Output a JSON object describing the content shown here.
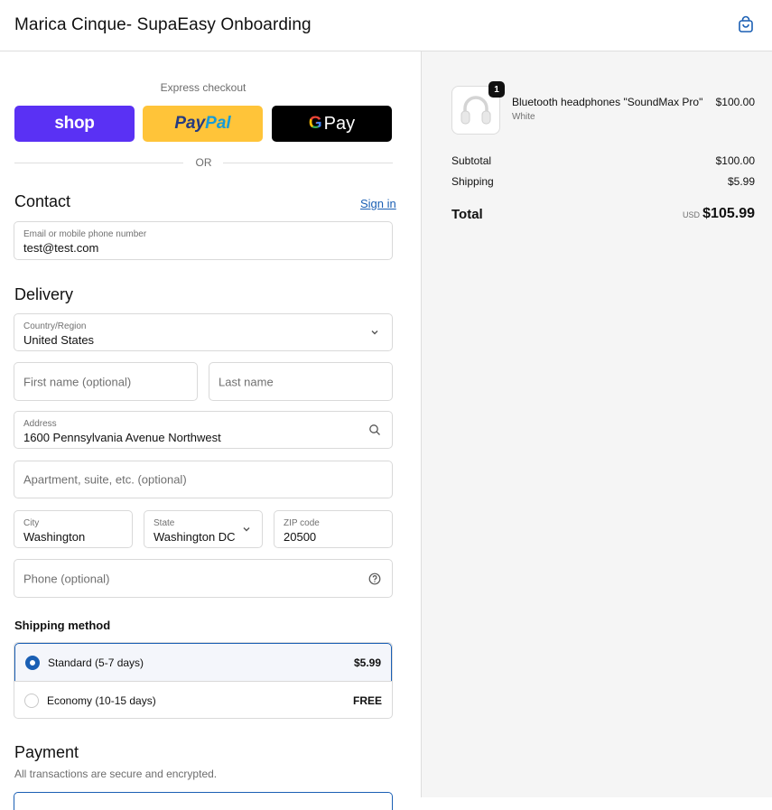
{
  "header": {
    "store_name": "Marica Cinque- SupaEasy Onboarding",
    "cart_icon": "shopping-bag-icon"
  },
  "express": {
    "label": "Express checkout",
    "shop_label": "shop",
    "paypal_part1": "Pay",
    "paypal_part2": "Pal",
    "gpay_g": "G",
    "gpay_label": "Pay",
    "or_label": "OR"
  },
  "contact": {
    "title": "Contact",
    "sign_in": "Sign in",
    "email_label": "Email or mobile phone number",
    "email_value": "test@test.com"
  },
  "delivery": {
    "title": "Delivery",
    "country_label": "Country/Region",
    "country_value": "United States",
    "first_name_placeholder": "First name (optional)",
    "last_name_placeholder": "Last name",
    "address_label": "Address",
    "address_value": "1600 Pennsylvania Avenue Northwest",
    "apartment_placeholder": "Apartment, suite, etc. (optional)",
    "city_label": "City",
    "city_value": "Washington",
    "state_label": "State",
    "state_value": "Washington DC",
    "zip_label": "ZIP code",
    "zip_value": "20500",
    "phone_placeholder": "Phone (optional)"
  },
  "shipping": {
    "title": "Shipping method",
    "options": [
      {
        "name": "Standard (5-7 days)",
        "price": "$5.99",
        "selected": true
      },
      {
        "name": "Economy (10-15 days)",
        "price": "FREE",
        "selected": false
      }
    ]
  },
  "payment": {
    "title": "Payment",
    "subtitle": "All transactions are secure and encrypted."
  },
  "summary": {
    "product": {
      "quantity": "1",
      "name": "Bluetooth headphones \"SoundMax Pro\"",
      "variant": "White",
      "price": "$100.00"
    },
    "subtotal_label": "Subtotal",
    "subtotal_value": "$100.00",
    "shipping_label": "Shipping",
    "shipping_value": "$5.99",
    "total_label": "Total",
    "currency": "USD",
    "total_value": "$105.99"
  },
  "colors": {
    "accent": "#1a5fb4",
    "shop": "#5a31f4",
    "paypal": "#ffc439",
    "gpay": "#000000",
    "summary_bg": "#f5f5f5"
  }
}
